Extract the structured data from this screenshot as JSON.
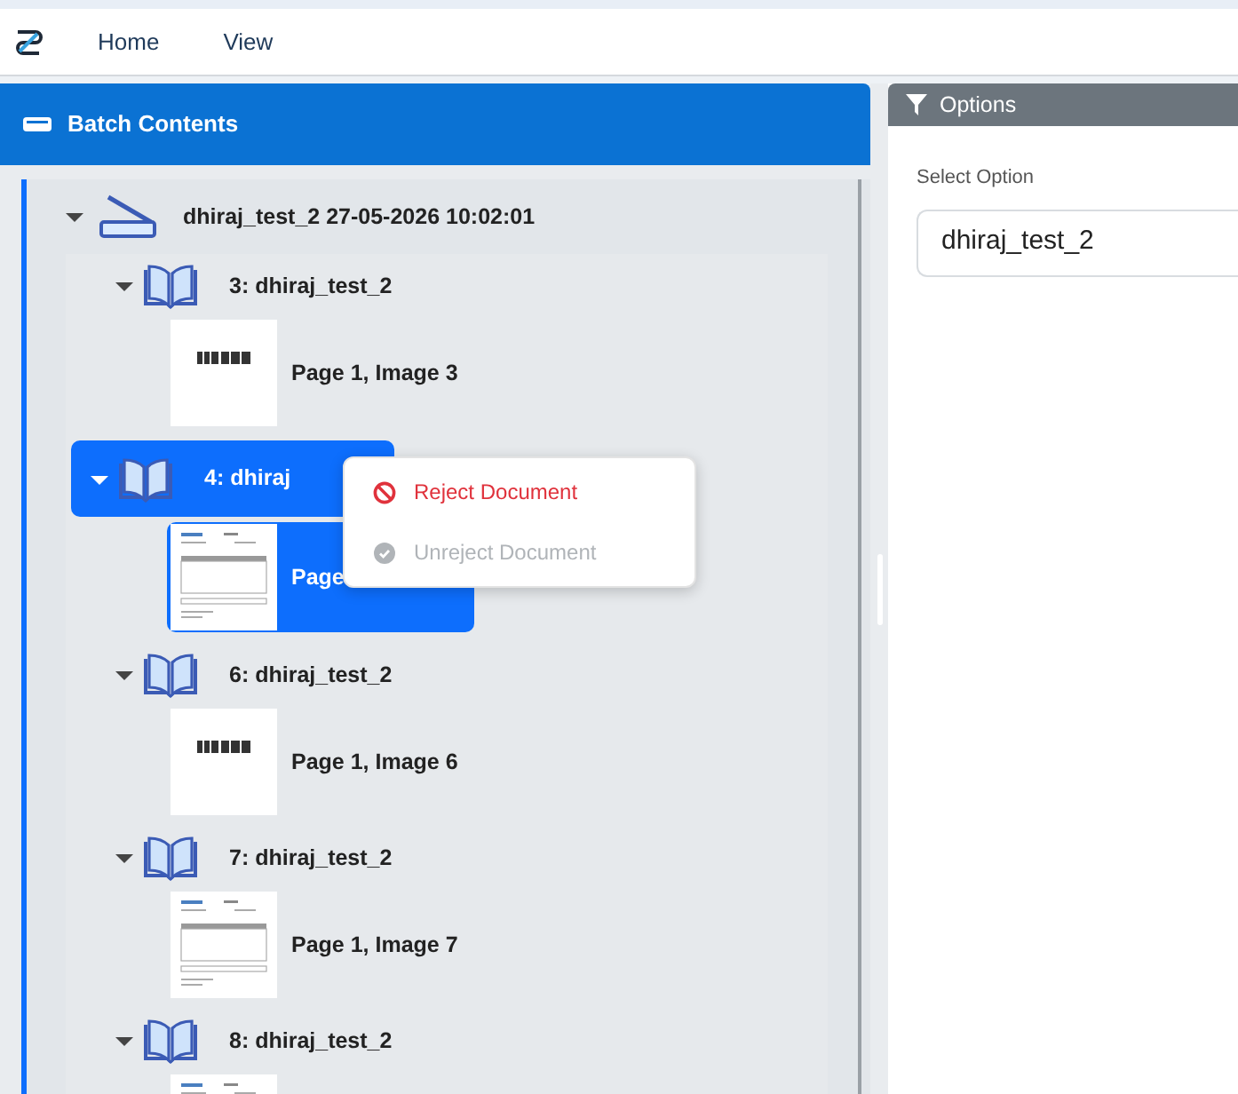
{
  "nav": {
    "items": [
      "Home",
      "View"
    ]
  },
  "batch_panel": {
    "title": "Batch Contents",
    "root": {
      "label": "dhiraj_test_2 27-05-2026 10:02:01",
      "expanded": true,
      "documents": [
        {
          "title": "3: dhiraj_test_2",
          "expanded": true,
          "selected": false,
          "pages": [
            {
              "label": "Page 1, Image 3",
              "kind": "barcode",
              "selected": false
            }
          ]
        },
        {
          "title": "4: dhiraj",
          "expanded": true,
          "selected": true,
          "pages": [
            {
              "label": "Page",
              "kind": "invoice",
              "selected": true
            }
          ]
        },
        {
          "title": "6: dhiraj_test_2",
          "expanded": true,
          "selected": false,
          "pages": [
            {
              "label": "Page 1, Image 6",
              "kind": "barcode",
              "selected": false
            }
          ]
        },
        {
          "title": "7: dhiraj_test_2",
          "expanded": true,
          "selected": false,
          "pages": [
            {
              "label": "Page 1, Image 7",
              "kind": "invoice",
              "selected": false
            }
          ]
        },
        {
          "title": "8: dhiraj_test_2",
          "expanded": true,
          "selected": false,
          "pages": [
            {
              "kind": "invoice",
              "selected": false
            }
          ]
        }
      ]
    }
  },
  "context_menu": {
    "items": [
      {
        "label": "Reject Document",
        "kind": "reject",
        "disabled": false
      },
      {
        "label": "Unreject Document",
        "kind": "unreject",
        "disabled": true
      }
    ]
  },
  "options_panel": {
    "title": "Options",
    "field_label": "Select Option",
    "value": "dhiraj_test_2"
  }
}
